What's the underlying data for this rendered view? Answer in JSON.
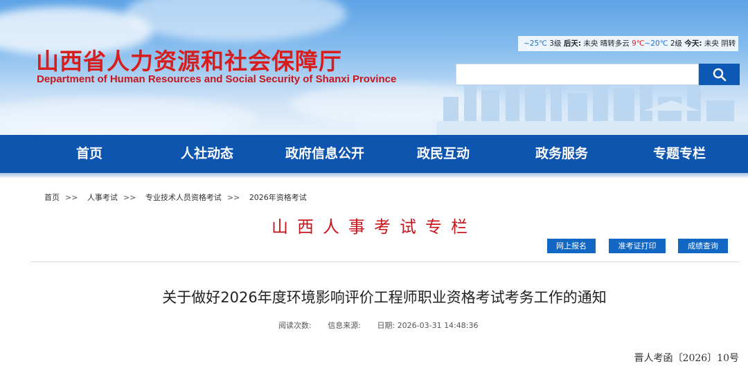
{
  "site": {
    "title_cn": "山西省人力资源和社会保障厅",
    "title_en": "Department of Human Resources and Social Security of Shanxi Province"
  },
  "weather": {
    "today_range_a": "~25℃",
    "level_a": "3级",
    "label_tomorrow": "后天:",
    "weather_a": "未央 晴转多云",
    "temp_hot": "9℃",
    "today_range_b": "~20℃",
    "level_b": "2级",
    "label_today": "今天:",
    "weather_b": "未央 阴转"
  },
  "search": {
    "placeholder": ""
  },
  "nav": {
    "items": [
      "首页",
      "人社动态",
      "政府信息公开",
      "政民互动",
      "政务服务",
      "专题专栏"
    ]
  },
  "breadcrumb": {
    "items": [
      "首页",
      "人事考试",
      "专业技术人员资格考试",
      "2026年资格考试"
    ],
    "separator": ">>"
  },
  "column": {
    "title": "山西人事考试专栏"
  },
  "quick_links": [
    "网上报名",
    "准考证打印",
    "成绩查询"
  ],
  "article": {
    "title": "关于做好2026年度环境影响评价工程师职业资格考试考务工作的通知",
    "meta_views": "阅读次数:",
    "meta_source": "信息来源:",
    "meta_date": "日期: 2026-03-31 14:48:36",
    "doc_number": "晋人考函〔2026〕10号"
  },
  "colors": {
    "brand_red": "#d81d1d",
    "nav_blue": "#0e55b0",
    "button_blue": "#1266c4"
  }
}
